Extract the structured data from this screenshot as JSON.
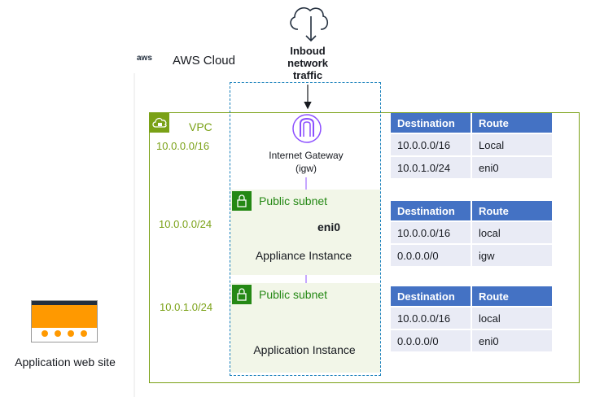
{
  "cloud": {
    "provider_mark": "aws",
    "title": "AWS Cloud"
  },
  "inbound": {
    "line1": "Inboud",
    "line2": "network",
    "line3": "traffic"
  },
  "vpc": {
    "label": "VPC",
    "cidr": "10.0.0.0/16"
  },
  "subnet1": {
    "label": "Public subnet",
    "cidr": "10.0.0.0/24"
  },
  "subnet2": {
    "label": "Public subnet",
    "cidr": "10.0.1.0/24"
  },
  "igw": {
    "line1": "Internet Gateway",
    "line2": "(igw)"
  },
  "appliance": {
    "name": "Appliance Instance",
    "eni": "eni0"
  },
  "application": {
    "name": "Application Instance"
  },
  "site": {
    "label": "Application web site"
  },
  "tables": [
    {
      "headers": [
        "Destination",
        "Route"
      ],
      "rows": [
        [
          "10.0.0.0/16",
          "Local"
        ],
        [
          "10.0.1.0/24",
          "eni0"
        ]
      ]
    },
    {
      "headers": [
        "Destination",
        "Route"
      ],
      "rows": [
        [
          "10.0.0.0/16",
          "local"
        ],
        [
          "0.0.0.0/0",
          "igw"
        ]
      ]
    },
    {
      "headers": [
        "Destination",
        "Route"
      ],
      "rows": [
        [
          "10.0.0.0/16",
          "local"
        ],
        [
          "0.0.0.0/0",
          "eni0"
        ]
      ]
    }
  ],
  "colors": {
    "vpc_green": "#7aa116",
    "subnet_green": "#248814",
    "az_blue": "#147eba",
    "table_header": "#4472c4",
    "table_cell": "#e9ebf5",
    "igw_purple": "#8c4fff",
    "instance_orange": "#ed7100"
  },
  "icons": [
    "cloud-download-icon",
    "vpc-cloud-lock-icon",
    "subnet-lock-icon",
    "internet-gateway-icon",
    "ec2-chip-icon",
    "eni-icon",
    "website-thumbnail-icon"
  ]
}
